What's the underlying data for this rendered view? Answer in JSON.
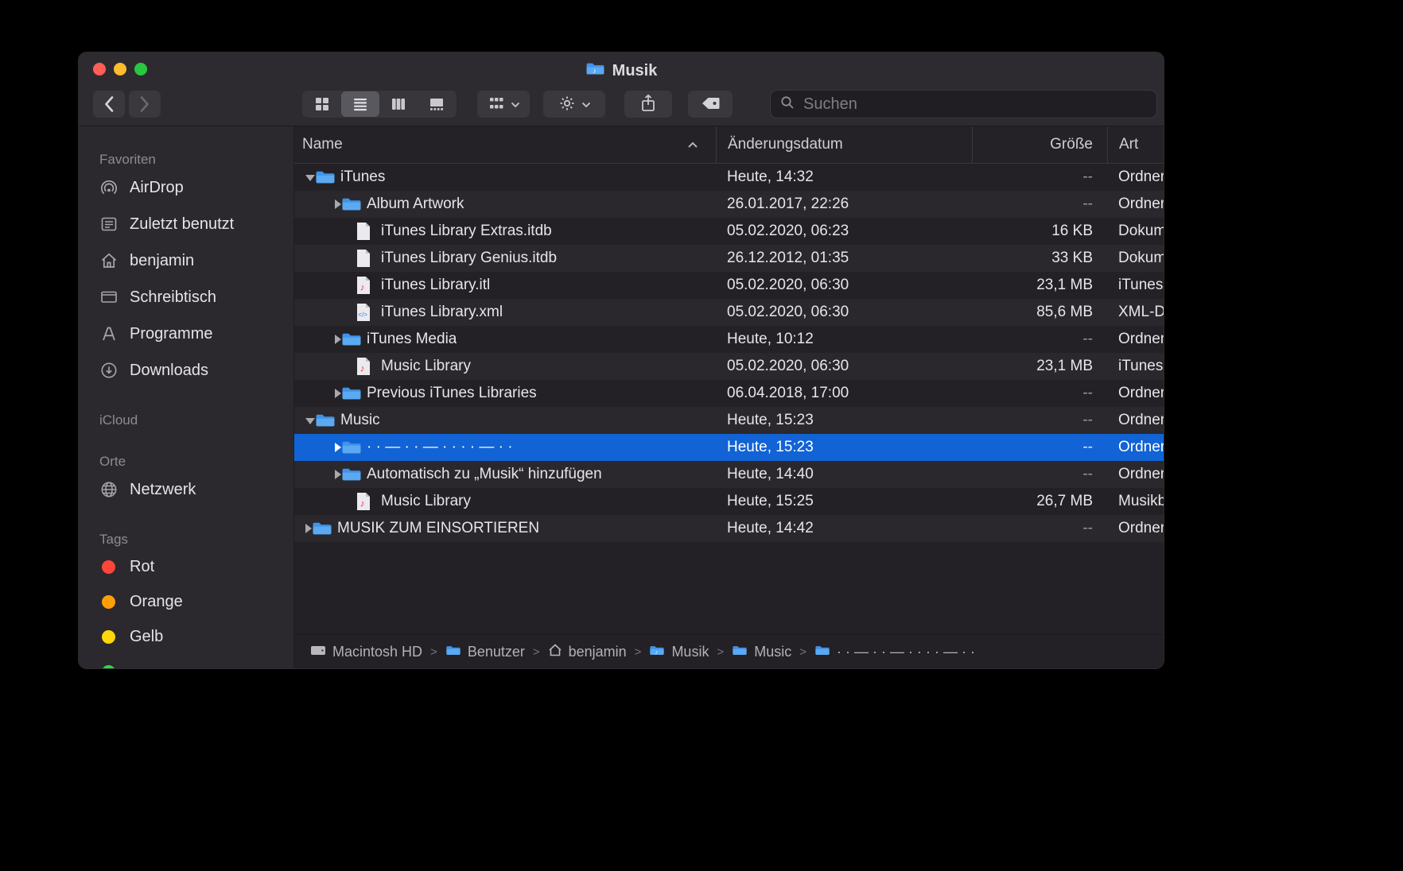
{
  "window": {
    "title": "Musik"
  },
  "toolbar": {
    "search_placeholder": "Suchen"
  },
  "sidebar": {
    "sections": [
      {
        "title": "Favoriten",
        "items": [
          {
            "label": "AirDrop",
            "icon": "airdrop"
          },
          {
            "label": "Zuletzt benutzt",
            "icon": "recents"
          },
          {
            "label": "benjamin",
            "icon": "home"
          },
          {
            "label": "Schreibtisch",
            "icon": "desktop"
          },
          {
            "label": "Programme",
            "icon": "applications"
          },
          {
            "label": "Downloads",
            "icon": "downloads"
          }
        ]
      },
      {
        "title": "iCloud",
        "items": []
      },
      {
        "title": "Orte",
        "items": [
          {
            "label": "Netzwerk",
            "icon": "network"
          }
        ]
      },
      {
        "title": "Tags",
        "items": [
          {
            "label": "Rot",
            "color": "#ff453a"
          },
          {
            "label": "Orange",
            "color": "#ff9f0a"
          },
          {
            "label": "Gelb",
            "color": "#ffd60a"
          },
          {
            "label": "",
            "color": "#32d74b"
          }
        ]
      }
    ]
  },
  "list": {
    "columns": [
      "Name",
      "Änderungsdatum",
      "Größe",
      "Art"
    ],
    "sort_column": "Name",
    "rows": [
      {
        "name": "iTunes",
        "date": "Heute, 14:32",
        "size": "--",
        "kind": "Ordner",
        "icon": "folder",
        "indent": 0,
        "disclosure": "down",
        "selected": false
      },
      {
        "name": "Album Artwork",
        "date": "26.01.2017, 22:26",
        "size": "--",
        "kind": "Ordner",
        "icon": "folder",
        "indent": 1,
        "disclosure": "right",
        "selected": false
      },
      {
        "name": "iTunes Library Extras.itdb",
        "date": "05.02.2020, 06:23",
        "size": "16 KB",
        "kind": "Dokument",
        "icon": "doc",
        "indent": 1,
        "disclosure": null,
        "selected": false
      },
      {
        "name": "iTunes Library Genius.itdb",
        "date": "26.12.2012, 01:35",
        "size": "33 KB",
        "kind": "Dokument",
        "icon": "doc",
        "indent": 1,
        "disclosure": null,
        "selected": false
      },
      {
        "name": "iTunes Library.itl",
        "date": "05.02.2020, 06:30",
        "size": "23,1 MB",
        "kind": "iTunes Library",
        "icon": "itunes-doc",
        "indent": 1,
        "disclosure": null,
        "selected": false
      },
      {
        "name": "iTunes Library.xml",
        "date": "05.02.2020, 06:30",
        "size": "85,6 MB",
        "kind": "XML-Dokument",
        "icon": "xml-doc",
        "indent": 1,
        "disclosure": null,
        "selected": false
      },
      {
        "name": "iTunes Media",
        "date": "Heute, 10:12",
        "size": "--",
        "kind": "Ordner",
        "icon": "folder",
        "indent": 1,
        "disclosure": "right",
        "selected": false
      },
      {
        "name": "Music Library",
        "date": "05.02.2020, 06:30",
        "size": "23,1 MB",
        "kind": "iTunes Library",
        "icon": "itunes-doc",
        "indent": 1,
        "disclosure": null,
        "selected": false
      },
      {
        "name": "Previous iTunes Libraries",
        "date": "06.04.2018, 17:00",
        "size": "--",
        "kind": "Ordner",
        "icon": "folder",
        "indent": 1,
        "disclosure": "right",
        "selected": false
      },
      {
        "name": "Music",
        "date": "Heute, 15:23",
        "size": "--",
        "kind": "Ordner",
        "icon": "folder",
        "indent": 0,
        "disclosure": "down",
        "selected": false
      },
      {
        "name": "· · — · · — · · · · — · ·",
        "date": "Heute, 15:23",
        "size": "--",
        "kind": "Ordner",
        "icon": "folder",
        "indent": 1,
        "disclosure": "right",
        "selected": true
      },
      {
        "name": "Automatisch zu „Musik“ hinzufügen",
        "date": "Heute, 14:40",
        "size": "--",
        "kind": "Ordner",
        "icon": "folder",
        "indent": 1,
        "disclosure": "right",
        "selected": false
      },
      {
        "name": "Music Library",
        "date": "Heute, 15:25",
        "size": "26,7 MB",
        "kind": "Musikbibliothek",
        "icon": "music-doc",
        "indent": 1,
        "disclosure": null,
        "selected": false
      },
      {
        "name": "MUSIK ZUM EINSORTIEREN",
        "date": "Heute, 14:42",
        "size": "--",
        "kind": "Ordner",
        "icon": "folder",
        "indent": 0,
        "disclosure": "right",
        "selected": false
      }
    ]
  },
  "pathbar": {
    "items": [
      {
        "label": "Macintosh HD",
        "icon": "drive"
      },
      {
        "label": "Benutzer",
        "icon": "folder"
      },
      {
        "label": "benjamin",
        "icon": "home"
      },
      {
        "label": "Musik",
        "icon": "music-folder"
      },
      {
        "label": "Music",
        "icon": "folder"
      },
      {
        "label": "· · — · · — · · · · — · ·",
        "icon": "folder"
      }
    ]
  }
}
